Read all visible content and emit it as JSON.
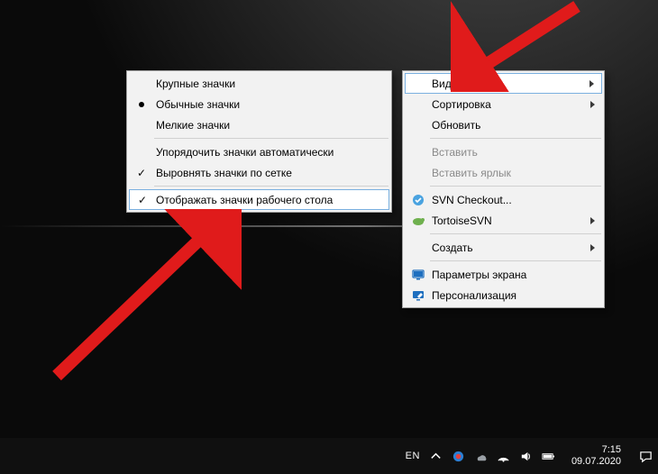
{
  "submenu": {
    "items": [
      {
        "label": "Крупные значки"
      },
      {
        "label": "Обычные значки",
        "bullet": true
      },
      {
        "label": "Мелкие значки"
      }
    ],
    "items2": [
      {
        "label": "Упорядочить значки автоматически"
      },
      {
        "label": "Выровнять значки по сетке",
        "checked": true
      }
    ],
    "items3": [
      {
        "label": "Отображать значки рабочего стола",
        "checked": true,
        "highlighted": true
      }
    ]
  },
  "main_menu": {
    "g1": [
      {
        "label": "Вид",
        "submenu": true,
        "highlighted": true
      },
      {
        "label": "Сортировка",
        "submenu": true
      },
      {
        "label": "Обновить"
      }
    ],
    "g2": [
      {
        "label": "Вставить",
        "disabled": true
      },
      {
        "label": "Вставить ярлык",
        "disabled": true
      }
    ],
    "g3": [
      {
        "label": "SVN Checkout...",
        "icon": "svn"
      },
      {
        "label": "TortoiseSVN",
        "submenu": true,
        "icon": "tortoise"
      }
    ],
    "g4": [
      {
        "label": "Создать",
        "submenu": true
      }
    ],
    "g5": [
      {
        "label": "Параметры экрана",
        "icon": "display"
      },
      {
        "label": "Персонализация",
        "icon": "personalize"
      }
    ]
  },
  "taskbar": {
    "lang": "EN",
    "time": "7:15",
    "date": "09.07.2020"
  }
}
